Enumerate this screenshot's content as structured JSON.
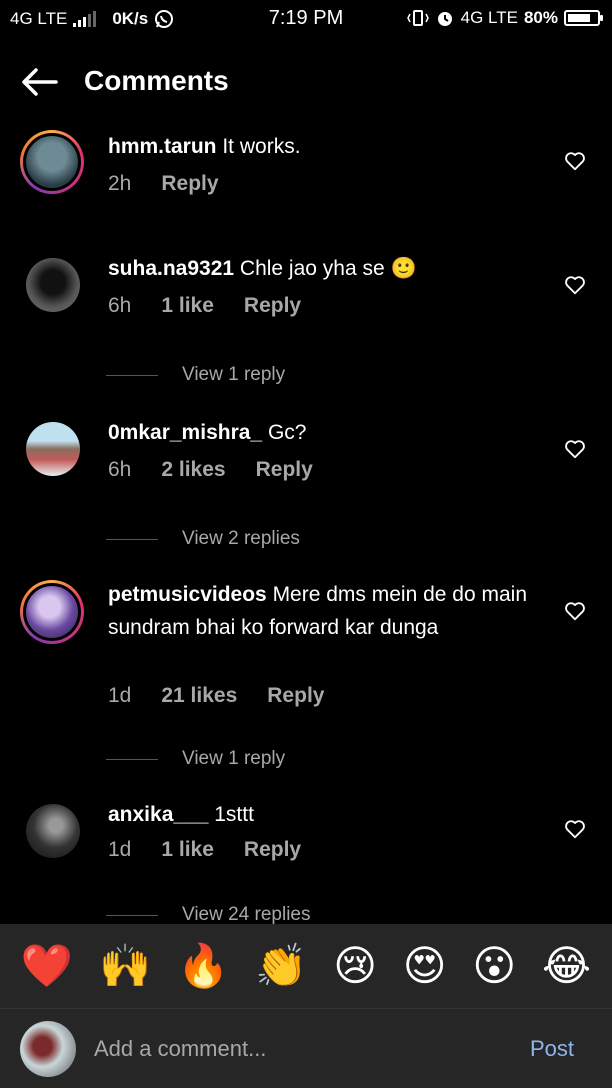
{
  "status_bar": {
    "network_left": "4G LTE",
    "speed": "0K/s",
    "time": "7:19 PM",
    "network_right": "4G LTE",
    "battery": "80%",
    "battery_level": 0.8
  },
  "header": {
    "title": "Comments"
  },
  "comments": [
    {
      "username": "hmm.tarun",
      "text": " It works.",
      "time": "2h",
      "likes": "",
      "reply_label": "Reply",
      "avatar_color": "#3d5a66"
    },
    {
      "username": "suha.na9321",
      "text": " Chle jao yha se 🙂",
      "time": "6h",
      "likes": "1 like",
      "reply_label": "Reply",
      "view_replies": "View 1 reply",
      "avatar_color": "#5a5a5a"
    },
    {
      "username": "0mkar_mishra_",
      "text": " Gc?",
      "time": "6h",
      "likes": "2 likes",
      "reply_label": "Reply",
      "view_replies": "View 2 replies",
      "avatar_color": "#7aa7b8"
    },
    {
      "username": "petmusicvideos",
      "text": " Mere dms mein de do main sundram bhai ko forward kar dunga",
      "time": "1d",
      "likes": "21 likes",
      "reply_label": "Reply",
      "view_replies": "View 1 reply",
      "avatar_color": "#6a4aa0"
    },
    {
      "username": "anxika___",
      "text": " 1sttt",
      "time": "1d",
      "likes": "1 like",
      "reply_label": "Reply",
      "view_replies": "View 24 replies",
      "avatar_color": "#444"
    }
  ],
  "reactions": [
    "❤️",
    "🙌",
    "🔥",
    "👏",
    "😢",
    "😍",
    "😮",
    "😂"
  ],
  "composer": {
    "placeholder": "Add a comment...",
    "post_label": "Post"
  },
  "colors": {
    "background": "#000000",
    "secondary_text": "#a8a8a8",
    "post_blue": "#8fb6ea",
    "panel": "#262626"
  }
}
